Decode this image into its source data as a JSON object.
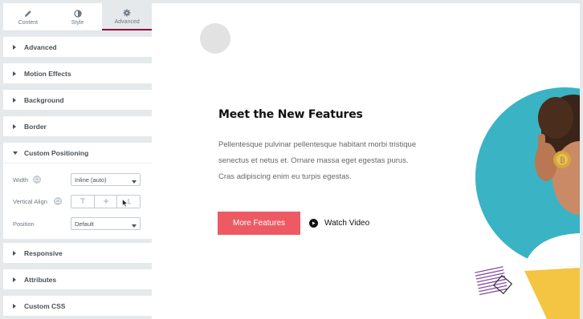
{
  "tabs": [
    {
      "label": "Content",
      "icon": "pencil-icon",
      "active": false
    },
    {
      "label": "Style",
      "icon": "contrast-icon",
      "active": false
    },
    {
      "label": "Advanced",
      "icon": "gear-icon",
      "active": true
    }
  ],
  "sections": {
    "advanced": "Advanced",
    "motion_effects": "Motion Effects",
    "background": "Background",
    "border": "Border",
    "custom_positioning": "Custom Positioning",
    "responsive": "Responsive",
    "attributes": "Attributes",
    "custom_css": "Custom CSS"
  },
  "custom_positioning": {
    "width_label": "Width",
    "width_value": "Inline (auto)",
    "vertical_align_label": "Vertical Align",
    "vertical_align_options": [
      "top",
      "middle",
      "bottom"
    ],
    "position_label": "Position",
    "position_value": "Default"
  },
  "preview": {
    "headline": "Meet the New Features",
    "body": "Pellentesque pulvinar pellentesque habitant morbi tristique senectus et netus et. Ornare massa eget egestas purus. Cras adipiscing enim eu turpis egestas.",
    "primary_button": "More Features",
    "secondary_button": "Watch Video"
  },
  "colors": {
    "accent_tab": "#93003c",
    "primary_button": "#ee5a63",
    "photo_bg": "#3ab3c4",
    "decor_purple": "#8a4fa0",
    "decor_yellow": "#f4c542"
  }
}
